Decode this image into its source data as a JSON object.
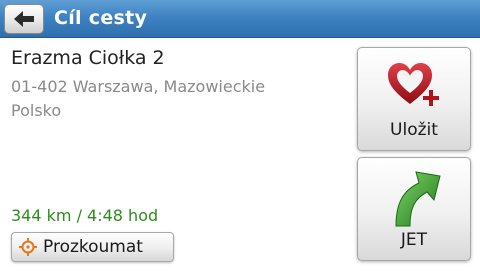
{
  "header": {
    "title": "Cíl cesty",
    "back_icon": "arrow-left-icon"
  },
  "address": {
    "name": "Erazma Ciołka 2",
    "line2": "01-402 Warszawa, Mazowieckie",
    "line3": "Polsko"
  },
  "route": {
    "info": "344 km / 4:48 hod"
  },
  "buttons": {
    "explore_label": "Prozkoumat",
    "save_label": "Uložit",
    "go_label": "JET"
  },
  "colors": {
    "header": "#3f83c2",
    "route_info": "#2e8b1e",
    "heart": "#b0141e",
    "arrow": "#3a9a2a"
  }
}
